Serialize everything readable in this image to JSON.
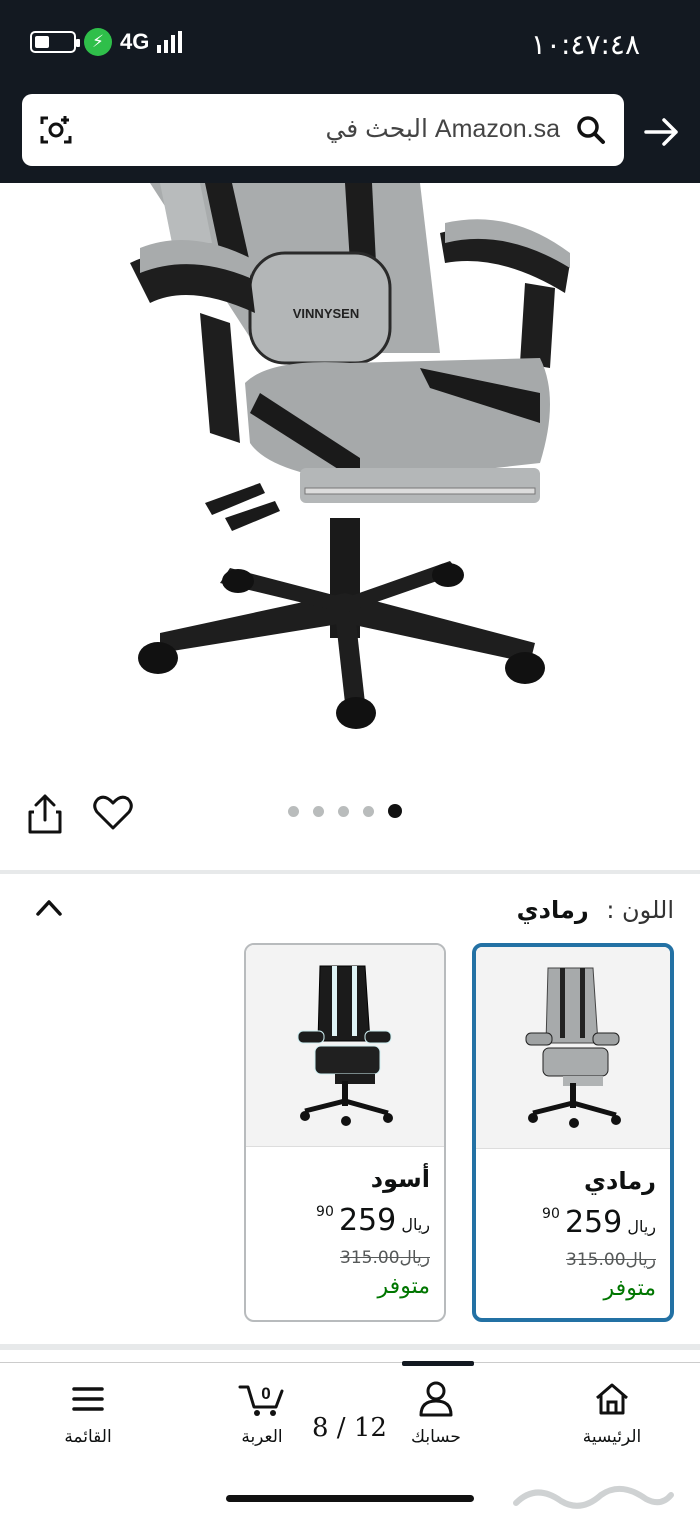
{
  "status_bar": {
    "time": "١٠:٤٧:٤٨",
    "network": "4G",
    "icons": [
      "battery-icon",
      "charging-icon",
      "signal-icon"
    ]
  },
  "search": {
    "placeholder": "البحث في Amazon.sa",
    "icons": [
      "camera-scan-icon",
      "search-icon",
      "back-arrow-icon"
    ]
  },
  "product_image": {
    "brand_text": "VINNYSEN",
    "carousel_total": 5,
    "carousel_active_index": 4
  },
  "variation": {
    "label": "اللون",
    "separator": ":",
    "selected": "رمادي",
    "options": [
      {
        "name": "رمادي",
        "price_whole": "259",
        "price_fraction": "90",
        "currency": "ريال",
        "list_price": "315.00",
        "list_currency": "ريال",
        "availability": "متوفر",
        "selected": true
      },
      {
        "name": "أسود",
        "price_whole": "259",
        "price_fraction": "90",
        "currency": "ريال",
        "list_price": "315.00",
        "list_currency": "ريال",
        "availability": "متوفر",
        "selected": false
      }
    ]
  },
  "bottom_nav": {
    "home": "الرئيسية",
    "account": "حسابك",
    "cart": "العربة",
    "cart_count": "0",
    "menu": "القائمة"
  },
  "page_counter": "8 / 12",
  "colors": {
    "header_bg": "#131921",
    "selected_border": "#2371a4",
    "in_stock": "#007600"
  }
}
